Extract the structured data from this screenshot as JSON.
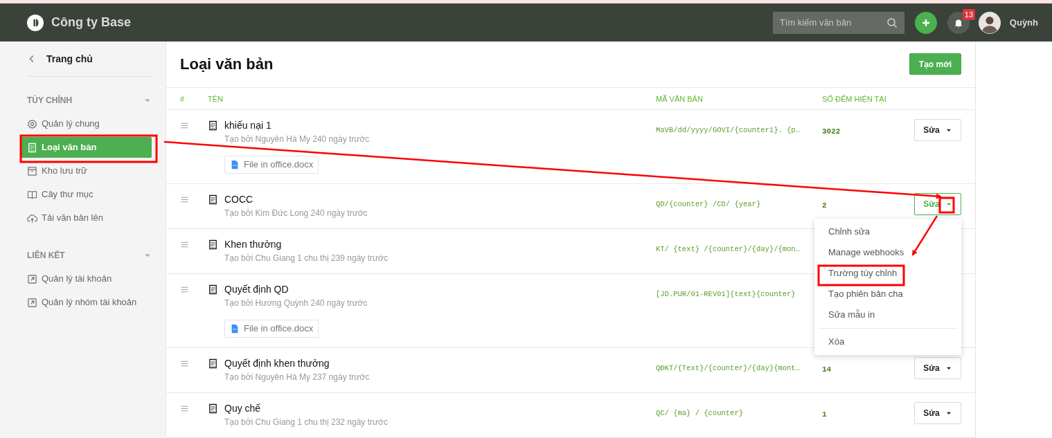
{
  "header": {
    "company": "Công ty Base",
    "search": {
      "placeholder": "Tìm kiếm văn bản"
    },
    "notifications": "13",
    "user": "Quỳnh"
  },
  "sidebar": {
    "back": "Trang chủ",
    "sections": [
      {
        "title": "TÙY CHỈNH",
        "expanded": true,
        "items": [
          {
            "label": "Quản lý chung",
            "selected": false
          },
          {
            "label": "Loại văn bản",
            "selected": true
          },
          {
            "label": "Kho lưu trữ",
            "selected": false
          },
          {
            "label": "Cây thư mục",
            "selected": false
          },
          {
            "label": "Tải văn bản lên",
            "selected": false
          }
        ]
      },
      {
        "title": "LIÊN KẾT",
        "expanded": true,
        "items": [
          {
            "label": "Quản lý tài khoản",
            "selected": false
          },
          {
            "label": "Quản lý nhóm tài khoản",
            "selected": false
          }
        ]
      }
    ]
  },
  "page": {
    "title": "Loại văn bản",
    "create_button": "Tạo mới"
  },
  "table": {
    "columns": [
      "#",
      "TÊN",
      "MÃ VĂN BẢN",
      "SỐ ĐẾM HIỆN TẠI"
    ],
    "rows": [
      {
        "name": "khiếu nại 1",
        "meta": "Tạo bởi Nguyên Hà My 240 ngày trước",
        "attachment": "File in office.docx",
        "code": "MaVB/dd/yyyy/GOVI/{counter1}. {p…",
        "count": "3022",
        "button": "Sửa",
        "open": false
      },
      {
        "name": "COCC",
        "meta": "Tạo bởi Kim Đức Long 240 ngày trước",
        "code": "QD/{counter} /CD/ {year}",
        "count": "2",
        "button": "Sửa",
        "open": true
      },
      {
        "name": "Khen thưởng",
        "meta": "Tạo bởi Chu Giang 1 chu thị 239 ngày trước",
        "code": "KT/ {text} /{counter}/{day}/{mon…"
      },
      {
        "name": "Quyết định QD",
        "meta": "Tạo bởi Hương Quỳnh 240 ngày trước",
        "attachment": "File in office.docx",
        "code": "[JD.PUR/01-REV01]{text}{counter}"
      },
      {
        "name": "Quyết định khen thưởng",
        "meta": "Tạo bởi Nguyên Hà My 237 ngày trước",
        "code": "QĐKT/{Text}/{counter}/{day}{mont…",
        "count": "14",
        "button": "Sửa",
        "open": false
      },
      {
        "name": "Quy chế",
        "meta": "Tạo bởi Chu Giang 1 chu thị 232 ngày trước",
        "code": "QC/ {ma} / {counter}",
        "count": "1",
        "button": "Sửa",
        "open": false
      }
    ]
  },
  "dropdown_menu": {
    "items": [
      {
        "label": "Chỉnh sửa",
        "divider_before": false
      },
      {
        "label": "Manage webhooks",
        "divider_before": false
      },
      {
        "label": "Trường tùy chỉnh",
        "divider_before": false
      },
      {
        "label": "Tạo phiên bản cha",
        "divider_before": false
      },
      {
        "label": "Sửa mẫu in",
        "divider_before": false
      },
      {
        "label": "Xóa",
        "divider_before": true
      }
    ]
  }
}
